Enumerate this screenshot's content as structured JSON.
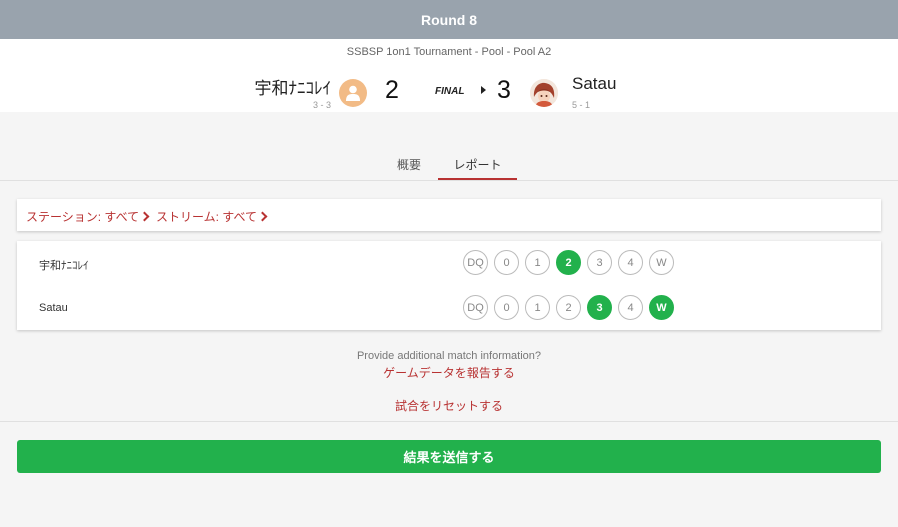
{
  "header": {
    "round_title": "Round 8",
    "tournament": "SSBSP 1on1 Tournament - Pool - Pool A2",
    "player1": {
      "name": "宇和ﾅﾆｺﾚｲ",
      "record": "3 - 3",
      "score": "2"
    },
    "status": "FINAL",
    "player2": {
      "name": "Satau",
      "record": "5 - 1",
      "score": "3"
    }
  },
  "tabs": [
    {
      "label": "概要"
    },
    {
      "label": "レポート"
    }
  ],
  "filters": {
    "station": "ステーション: すべて",
    "stream": "ストリーム: すべて"
  },
  "report": {
    "rows": [
      {
        "name": "宇和ﾅﾆｺﾚｲ",
        "options": [
          "DQ",
          "0",
          "1",
          "2",
          "3",
          "4",
          "W"
        ],
        "selected": [
          "2"
        ]
      },
      {
        "name": "Satau",
        "options": [
          "DQ",
          "0",
          "1",
          "2",
          "3",
          "4",
          "W"
        ],
        "selected": [
          "3",
          "W"
        ]
      }
    ]
  },
  "footer": {
    "info_text": "Provide additional match information?",
    "report_link": "ゲームデータを報告する",
    "reset_link": "試合をリセットする",
    "submit_label": "結果を送信する"
  },
  "colors": {
    "topbar": "#99a3ad",
    "accent_red": "#b83232",
    "selected_green": "#22b14c",
    "avatar_orange": "#f2bb86"
  }
}
